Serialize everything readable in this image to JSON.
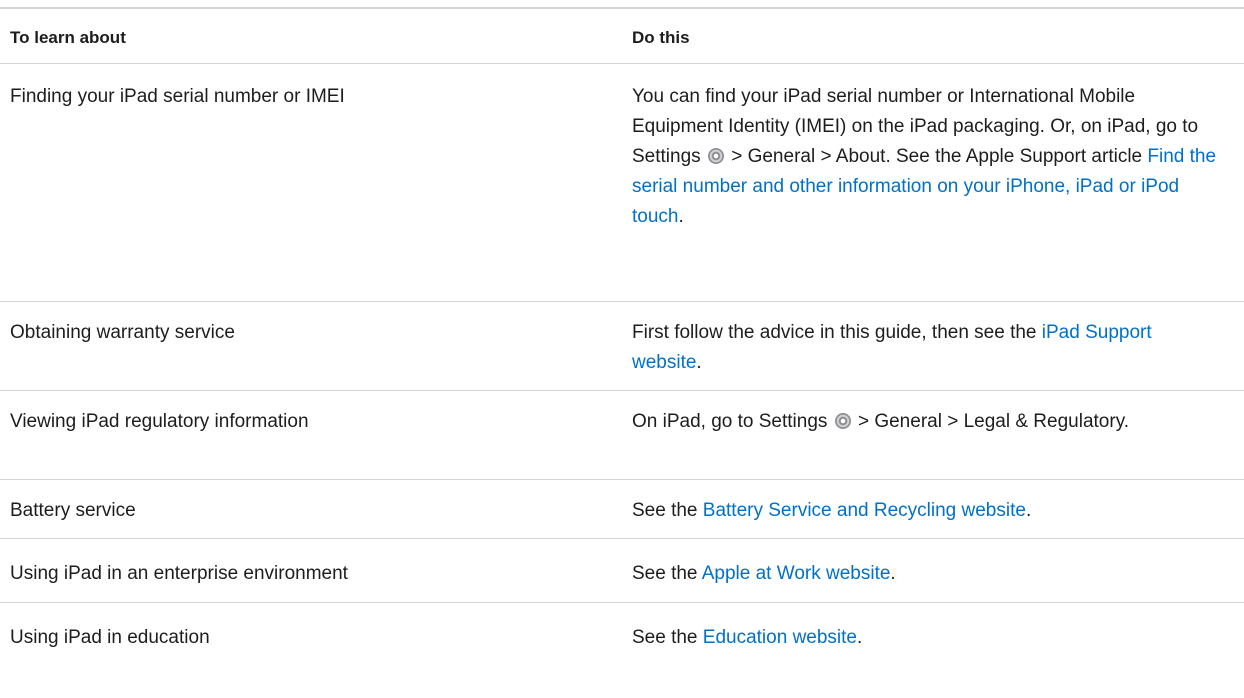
{
  "headers": {
    "learn": "To learn about",
    "do": "Do this"
  },
  "rows": [
    {
      "topic": "Finding your iPad serial number or IMEI",
      "t1": "You can find your iPad serial number or International Mobile Equipment Identity (IMEI) on the iPad packaging. Or, on iPad, go to Settings",
      "icon": "settings-gear-icon",
      "t2": " > General > About. See the Apple Support article ",
      "link": "Find the serial number and other information on your iPhone, iPad or iPod touch",
      "t3": "."
    },
    {
      "topic": "Obtaining warranty service",
      "t1": "First follow the advice in this guide, then see the ",
      "link": "iPad Support website",
      "t3": "."
    },
    {
      "topic": "Viewing iPad regulatory information",
      "t1": "On iPad, go to Settings",
      "icon": "settings-gear-icon",
      "t2": " > General > Legal & Regulatory."
    },
    {
      "topic": "Battery service",
      "t1": "See the ",
      "link": "Battery Service and Recycling website",
      "t3": "."
    },
    {
      "topic": "Using iPad in an enterprise environment",
      "t1": "See the ",
      "link": "Apple at Work website",
      "t3": "."
    },
    {
      "topic": "Using iPad in education",
      "t1": "See the ",
      "link": "Education website",
      "t3": "."
    }
  ],
  "colors": {
    "text": "#1d1d1f",
    "link": "#0070c9",
    "divider": "#d2d2d7"
  }
}
